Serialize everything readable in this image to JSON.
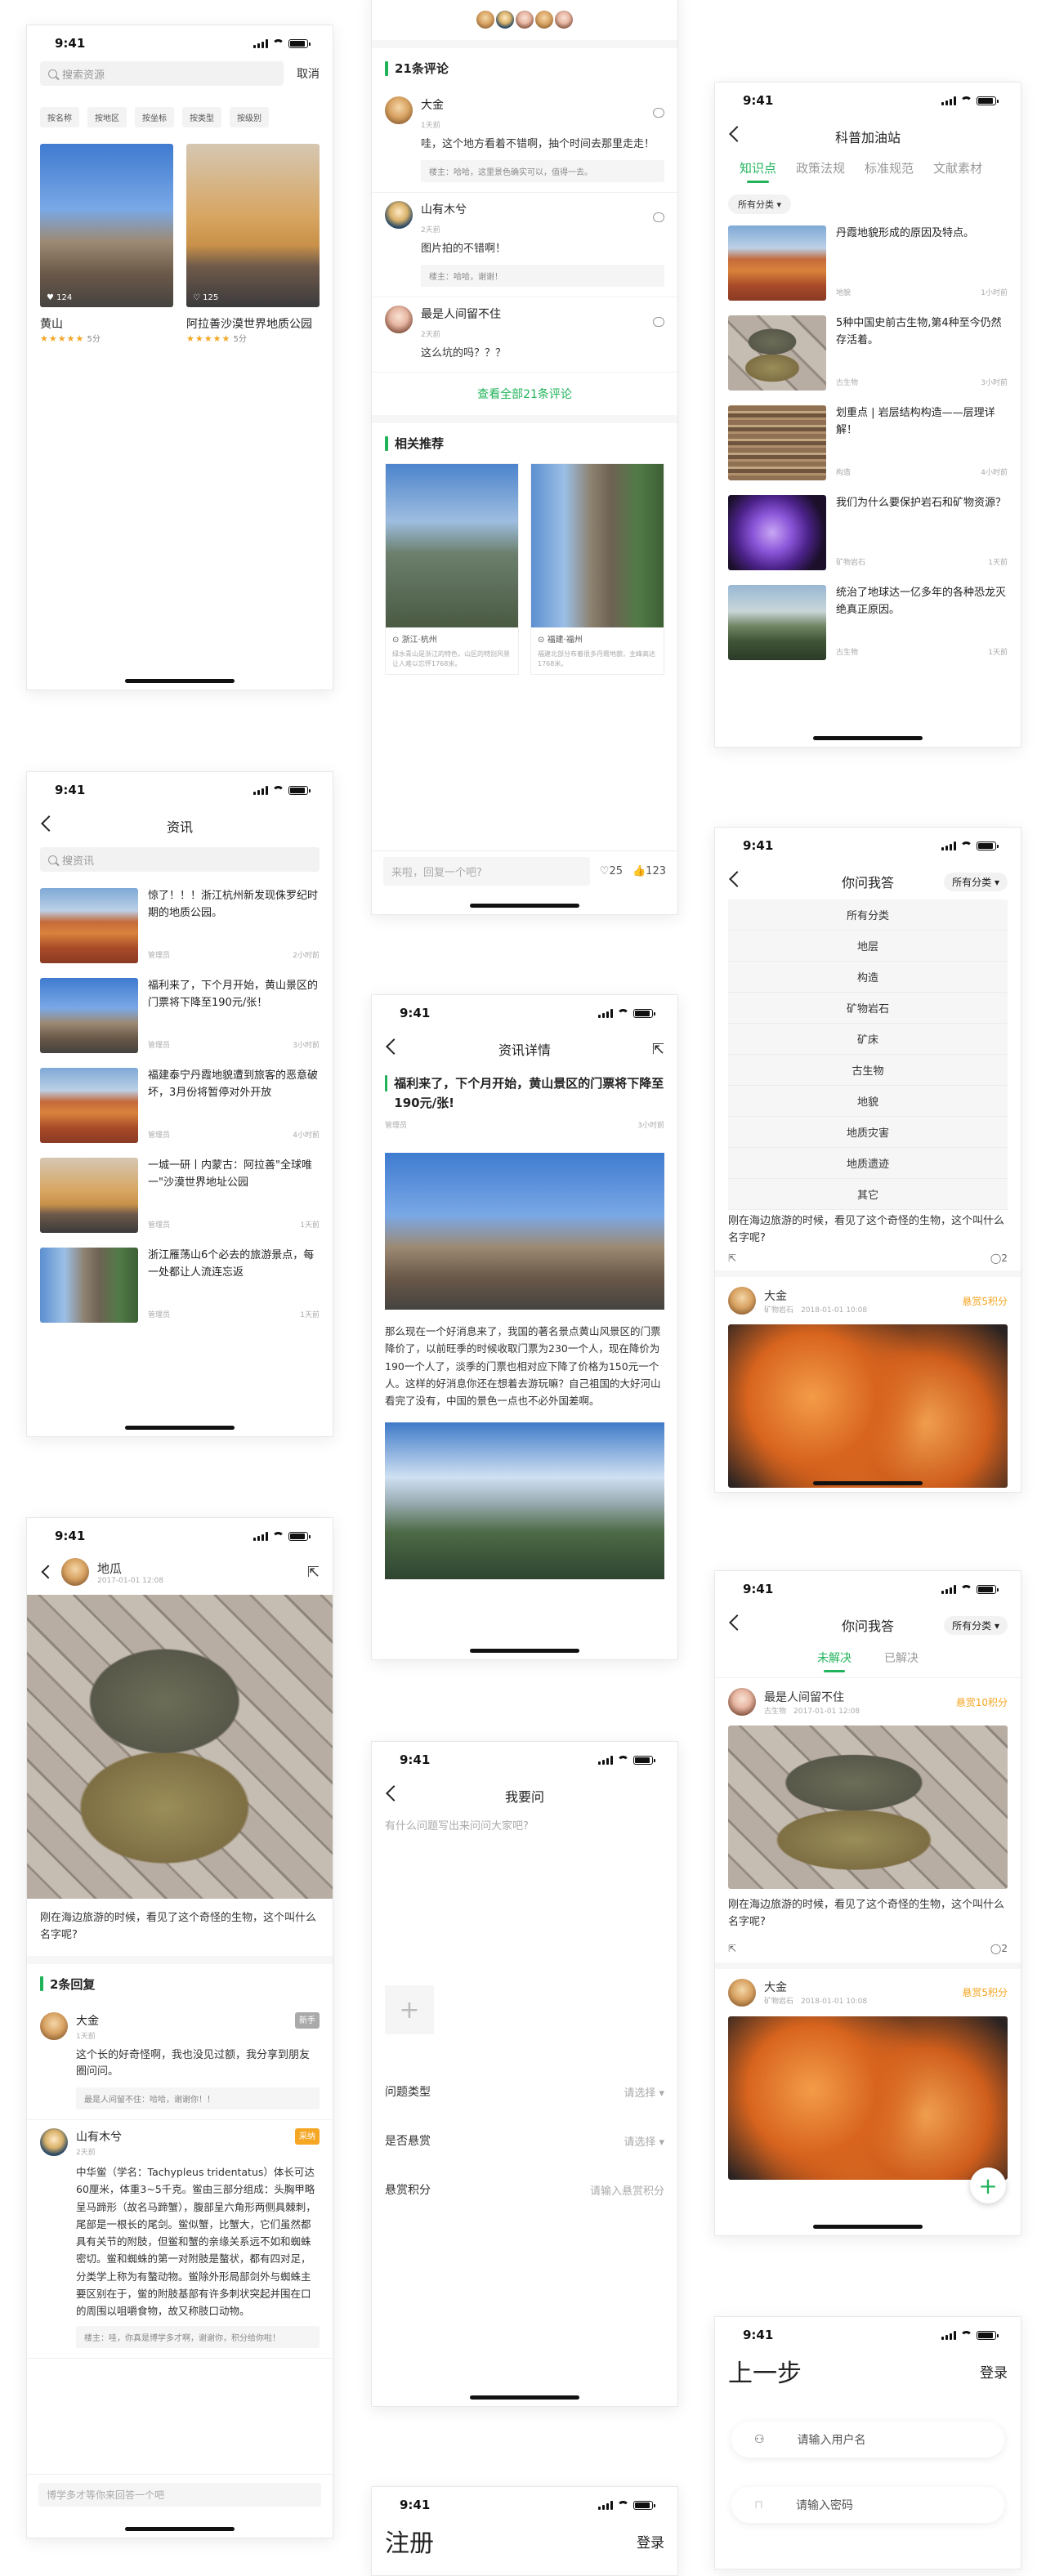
{
  "status": {
    "time": "9:41"
  },
  "screen_search": {
    "placeholder": "搜索资源",
    "cancel": "取消",
    "tags": [
      "按名称",
      "按地区",
      "按坐标",
      "按类型",
      "按级别"
    ],
    "cards": [
      {
        "name": "黄山",
        "likes": "124",
        "score": "5分",
        "stars": "★★★★★"
      },
      {
        "name": "阿拉善沙漠世界地质公园",
        "likes": "125",
        "score": "5分",
        "stars": "★★★★★"
      }
    ]
  },
  "screen_detail_comments": {
    "section": "21条评论",
    "comments": [
      {
        "name": "大金",
        "time": "1天前",
        "text": "哇，这个地方看着不错啊，抽个时间去那里走走！",
        "reply": "楼主：哈哈，这里景色确实可以，值得一去。"
      },
      {
        "name": "山有木兮",
        "time": "2天前",
        "text": "图片拍的不错啊！",
        "reply": "楼主：哈哈，谢谢！"
      },
      {
        "name": "最是人间留不住",
        "time": "2天前",
        "text": "这么坑的吗？？？",
        "reply": ""
      }
    ],
    "view_all": "查看全部21条评论",
    "related_title": "相关推荐",
    "related": [
      {
        "loc": "浙江·杭州",
        "desc": "绿水青山是浙江的特色，山区的特别风景让人难以忘怀1768米。"
      },
      {
        "loc": "福建·福州",
        "desc": "福建北部分布着很多丹霞地貌，主峰高达1768米。"
      }
    ],
    "reply_placeholder": "来啦，回复一个吧?",
    "like_count": "25",
    "thumb_count": "123"
  },
  "screen_station": {
    "title": "科普加油站",
    "tabs": [
      "知识点",
      "政策法规",
      "标准规范",
      "文献素材"
    ],
    "filter": "所有分类",
    "items": [
      {
        "title": "丹霞地貌形成的原因及特点。",
        "cat": "地貌",
        "time": "1小时前"
      },
      {
        "title": "5种中国史前古生物,第4种至今仍然存活着。",
        "cat": "古生物",
        "time": "3小时前"
      },
      {
        "title": "划重点 | 岩层结构构造——层理详解！",
        "cat": "构造",
        "time": "4小时前"
      },
      {
        "title": "我们为什么要保护岩石和矿物资源？",
        "cat": "矿物岩石",
        "time": "1天前"
      },
      {
        "title": "统治了地球达一亿多年的各种恐龙灭绝真正原因。",
        "cat": "古生物",
        "time": "1天前"
      }
    ]
  },
  "screen_news": {
    "title": "资讯",
    "placeholder": "搜资讯",
    "items": [
      {
        "title": "惊了！！！浙江杭州新发现侏罗纪时期的地质公园。",
        "src": "管理员",
        "time": "2小时前"
      },
      {
        "title": "福利来了，下个月开始，黄山景区的门票将下降至190元/张！",
        "src": "管理员",
        "time": "3小时前"
      },
      {
        "title": "福建泰宁丹霞地貌遭到旅客的恶意破坏，3月份将暂停对外开放",
        "src": "管理员",
        "time": "4小时前"
      },
      {
        "title": "一城一研丨内蒙古：阿拉善\"全球唯一\"沙漠世界地址公园",
        "src": "管理员",
        "time": "1天前"
      },
      {
        "title": "浙江雁荡山6个必去的旅游景点，每一处都让人流连忘返",
        "src": "管理员",
        "time": "1天前"
      }
    ]
  },
  "screen_qa_dropdown": {
    "title": "你问我答",
    "filter": "所有分类",
    "options": [
      "所有分类",
      "地层",
      "构造",
      "矿物岩石",
      "矿床",
      "古生物",
      "地貌",
      "地质灾害",
      "地质遗迹",
      "其它"
    ],
    "partial_text": "刚在海边旅游的时候，看见了这个奇怪的生物，这个叫什么名字呢?",
    "comment_count": "2",
    "post": {
      "name": "大金",
      "cat": "矿物岩石",
      "time": "2018-01-01 10:08",
      "reward": "悬赏5积分"
    }
  },
  "screen_news_detail": {
    "title": "资讯详情",
    "headline": "福利来了，下个月开始，黄山景区的门票将下降至190元/张!",
    "src": "管理员",
    "time": "3小时前",
    "body": "那么现在一个好消息来了，我国的著名景点黄山风景区的门票降价了，以前旺季的时候收取门票为230一个人，现在降价为190一个人了，淡季的门票也相对应下降了价格为150元一个人。这样的好消息你还在想着去游玩嘛？自己祖国的大好河山看完了没有，中国的景色一点也不必外国差啊。"
  },
  "screen_question": {
    "user": "地瓜",
    "time": "2017-01-01 12:08",
    "text": "刚在海边旅游的时候，看见了这个奇怪的生物，这个叫什么名字呢?",
    "replies_title": "2条回复",
    "replies": [
      {
        "name": "大金",
        "time": "1天前",
        "badge": "新手",
        "text": "这个长的好奇怪啊，我也没见过额，我分享到朋友圈问问。",
        "sub": "最是人间留不住：哈哈，谢谢你！！"
      },
      {
        "name": "山有木兮",
        "time": "2天前",
        "badge": "采纳",
        "text": "中华鲎（学名：Tachypleus tridentatus）体长可达60厘米，体重3~5千克。鲎由三部分组成：头胸甲略呈马蹄形（故名马蹄蟹），腹部呈六角形两侧具棘刺，尾部是一根长的尾剑。鲎似蟹，比蟹大，它们虽然都具有关节的附肢，但鲎和蟹的亲缘关系远不如和蜘蛛密切。鲎和蜘蛛的第一对附肢是螯状，都有四对足，分类学上称为有螯动物。鲎除外形局部剑外与蜘蛛主要区别在于，鲎的附肢基部有许多刺状突起并围在口的周围以咀嚼食物，故又称肢口动物。",
        "sub": "楼主：哇，你真是博学多才啊，谢谢你，积分给你啦！"
      }
    ],
    "input_placeholder": "博学多才等你来回答一个吧"
  },
  "screen_ask": {
    "title": "我要问",
    "placeholder": "有什么问题写出来问问大家吧?",
    "rows": [
      {
        "label": "问题类型",
        "value": "请选择"
      },
      {
        "label": "是否悬赏",
        "value": "请选择"
      },
      {
        "label": "悬赏积分",
        "value": "请输入悬赏积分"
      }
    ]
  },
  "screen_qa_list": {
    "title": "你问我答",
    "filter": "所有分类",
    "tabs": [
      "未解决",
      "已解决"
    ],
    "posts": [
      {
        "name": "最是人间留不住",
        "cat": "古生物",
        "time": "2017-01-01 12:08",
        "reward": "悬赏10积分",
        "text": "刚在海边旅游的时候，看见了这个奇怪的生物，这个叫什么名字呢?",
        "comments": "2"
      },
      {
        "name": "大金",
        "cat": "矿物岩石",
        "time": "2018-01-01 10:08",
        "reward": "悬赏5积分"
      }
    ]
  },
  "screen_login": {
    "title": "上一步",
    "action": "登录",
    "user_placeholder": "请输入用户名",
    "pwd_placeholder": "请输入密码"
  },
  "screen_register": {
    "title": "注册",
    "action": "登录"
  }
}
